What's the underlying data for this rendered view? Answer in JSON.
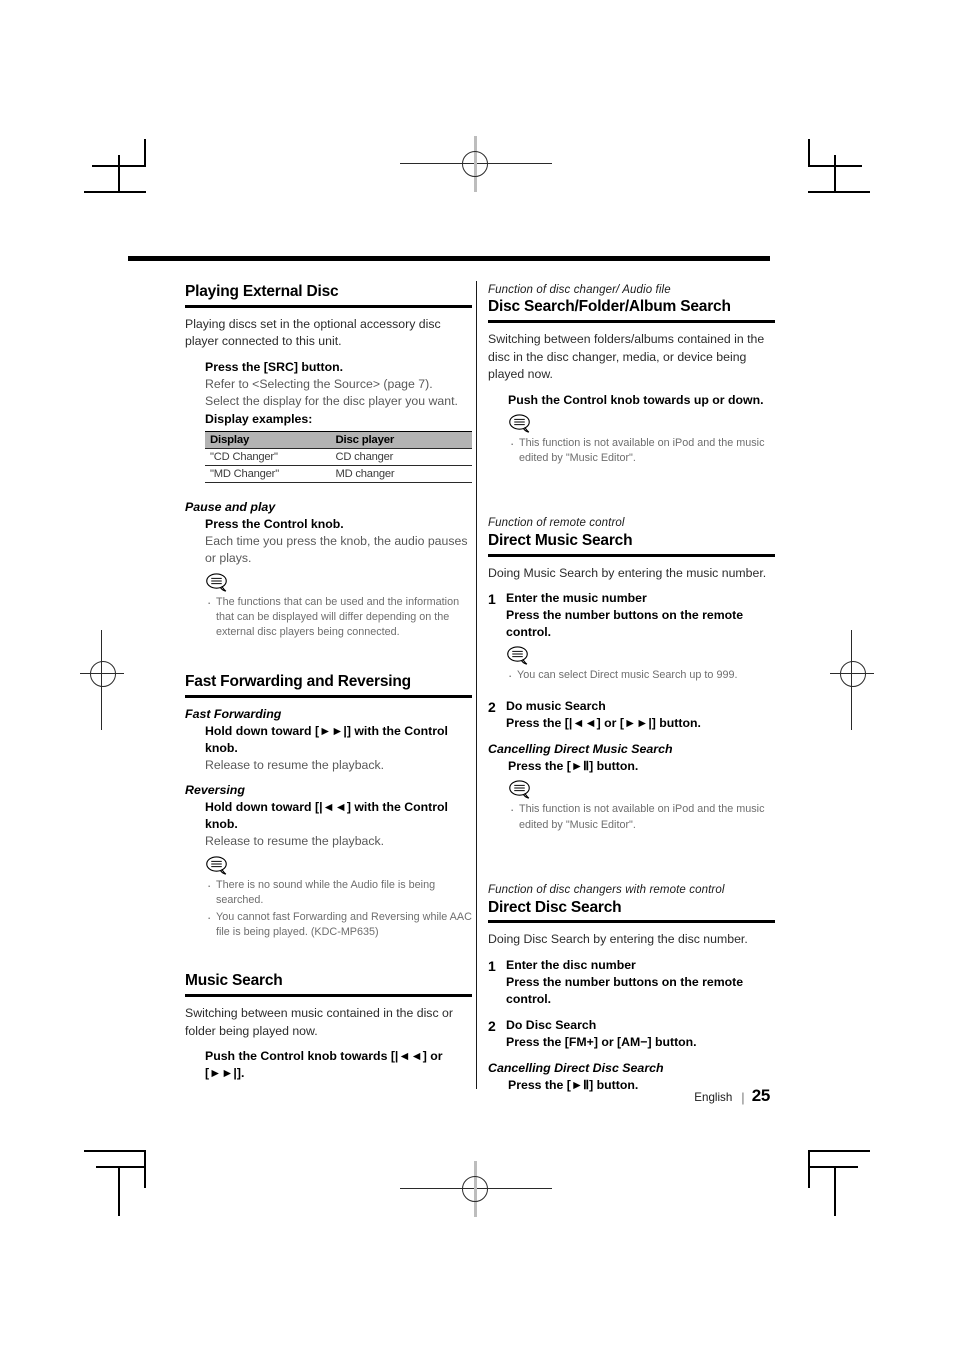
{
  "page": {
    "footer_language": "English",
    "footer_separator": "|",
    "footer_page_number": "25"
  },
  "left_column": {
    "playing_external_disc": {
      "title": "Playing External Disc",
      "intro": "Playing discs set in the optional accessory disc player connected to this unit.",
      "instruction": "Press the [SRC] button.",
      "detail_1": "Refer to <Selecting the Source> (page 7).",
      "detail_2": "Select the display for the disc player you want.",
      "display_examples_label": "Display examples:",
      "table": {
        "headers": [
          "Display",
          "Disc player"
        ],
        "rows": [
          [
            "\"CD Changer\"",
            "CD changer"
          ],
          [
            "\"MD Changer\"",
            "MD changer"
          ]
        ]
      }
    },
    "pause_and_play": {
      "title": "Pause and play",
      "instruction": "Press the Control knob.",
      "detail": "Each time you press the knob, the audio pauses or plays.",
      "notes": [
        "The functions that can be used and the information that can be displayed will differ depending on the external disc players being connected."
      ]
    },
    "fast_forwarding_and_reversing": {
      "title": "Fast Forwarding and Reversing",
      "fast_forwarding": {
        "title": "Fast Forwarding",
        "instruction": "Hold down toward [►►|] with the Control knob.",
        "detail": "Release to resume the playback."
      },
      "reversing": {
        "title": "Reversing",
        "instruction": "Hold down toward [|◄◄] with the Control knob.",
        "detail": "Release to resume the playback."
      },
      "notes": [
        "There is no sound while the Audio file is being searched.",
        "You cannot fast Forwarding and Reversing while AAC file is being played. (KDC-MP635)"
      ]
    },
    "music_search": {
      "title": "Music Search",
      "intro": "Switching between music contained in the disc or folder being played now.",
      "instruction": "Push the Control knob towards [|◄◄] or [►►|]."
    }
  },
  "right_column": {
    "disc_search": {
      "kicker": "Function of disc changer/ Audio file",
      "title": "Disc Search/Folder/Album Search",
      "intro": "Switching between folders/albums contained in the disc in the disc changer, media, or device being played now.",
      "instruction": "Push the Control knob towards up or down.",
      "notes": [
        "This function is not available on iPod and the music edited by \"Music Editor\"."
      ]
    },
    "direct_music_search": {
      "kicker": "Function of remote control",
      "title": "Direct Music Search",
      "intro": "Doing Music Search by entering the music number.",
      "step1": {
        "number": "1",
        "heading": "Enter the music number",
        "detail": "Press the number buttons on the remote control.",
        "notes": [
          "You can select Direct music Search up to 999."
        ]
      },
      "step2": {
        "number": "2",
        "heading": "Do music Search",
        "detail": "Press the [|◄◄] or [►►|] button."
      },
      "cancelling": {
        "title": "Cancelling Direct Music Search",
        "instruction": "Press the [►Ⅱ] button.",
        "notes": [
          "This function is not available on iPod and the music edited by \"Music Editor\"."
        ]
      }
    },
    "direct_disc_search": {
      "kicker": "Function of disc changers with remote control",
      "title": "Direct Disc Search",
      "intro": "Doing Disc Search by entering the disc number.",
      "step1": {
        "number": "1",
        "heading": "Enter the disc number",
        "detail": "Press the number buttons on the remote control."
      },
      "step2": {
        "number": "2",
        "heading": "Do Disc Search",
        "detail": "Press the [FM+] or [AM−] button."
      },
      "cancelling": {
        "title": "Cancelling Direct Disc Search",
        "instruction": "Press the [►Ⅱ] button."
      }
    }
  }
}
